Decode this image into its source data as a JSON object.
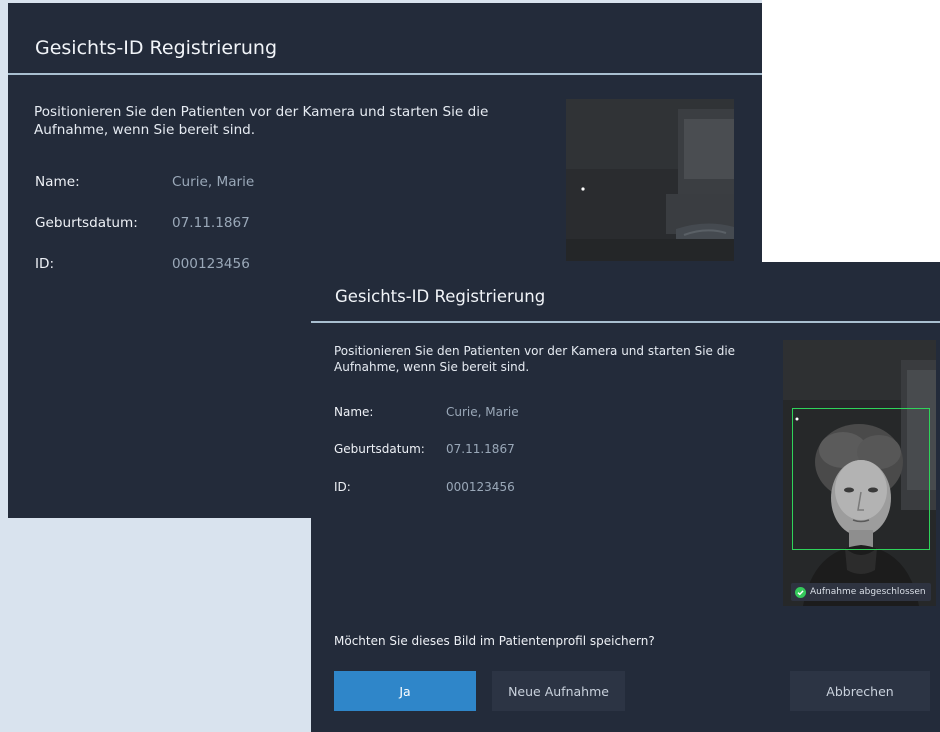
{
  "background_dialog": {
    "title": "Gesichts-ID Registrierung",
    "instruction_line1": "Positionieren Sie den Patienten vor der Kamera und starten Sie die",
    "instruction_line2": "Aufnahme, wenn Sie bereit sind.",
    "fields": [
      {
        "label": "Name:",
        "value": "Curie, Marie"
      },
      {
        "label": "Geburtsdatum:",
        "value": "07.11.1867"
      },
      {
        "label": "ID:",
        "value": "000123456"
      }
    ],
    "camera_preview_icon": "camera-feed-empty-room"
  },
  "front_dialog": {
    "title": "Gesichts-ID Registrierung",
    "instruction_line1": "Positionieren Sie den Patienten vor der Kamera und starten Sie die",
    "instruction_line2": "Aufnahme, wenn Sie bereit sind.",
    "fields": [
      {
        "label": "Name:",
        "value": "Curie, Marie"
      },
      {
        "label": "Geburtsdatum:",
        "value": "07.11.1867"
      },
      {
        "label": "ID:",
        "value": "000123456"
      }
    ],
    "camera_preview_icon": "camera-feed-face",
    "status_icon": "check-circle-icon",
    "status_text": "Aufnahme abgeschlossen",
    "question": "Möchten Sie dieses Bild im Patientenprofil speichern?",
    "buttons": {
      "yes": "Ja",
      "retake": "Neue Aufnahme",
      "cancel": "Abbrechen"
    }
  },
  "colors": {
    "dialog_bg": "#232b3a",
    "primary_button": "#2f86c9",
    "secondary_button": "#2c3444",
    "face_box": "#2fd35a",
    "divider": "#a9bfd0",
    "page_bg": "#d9e3ee"
  }
}
